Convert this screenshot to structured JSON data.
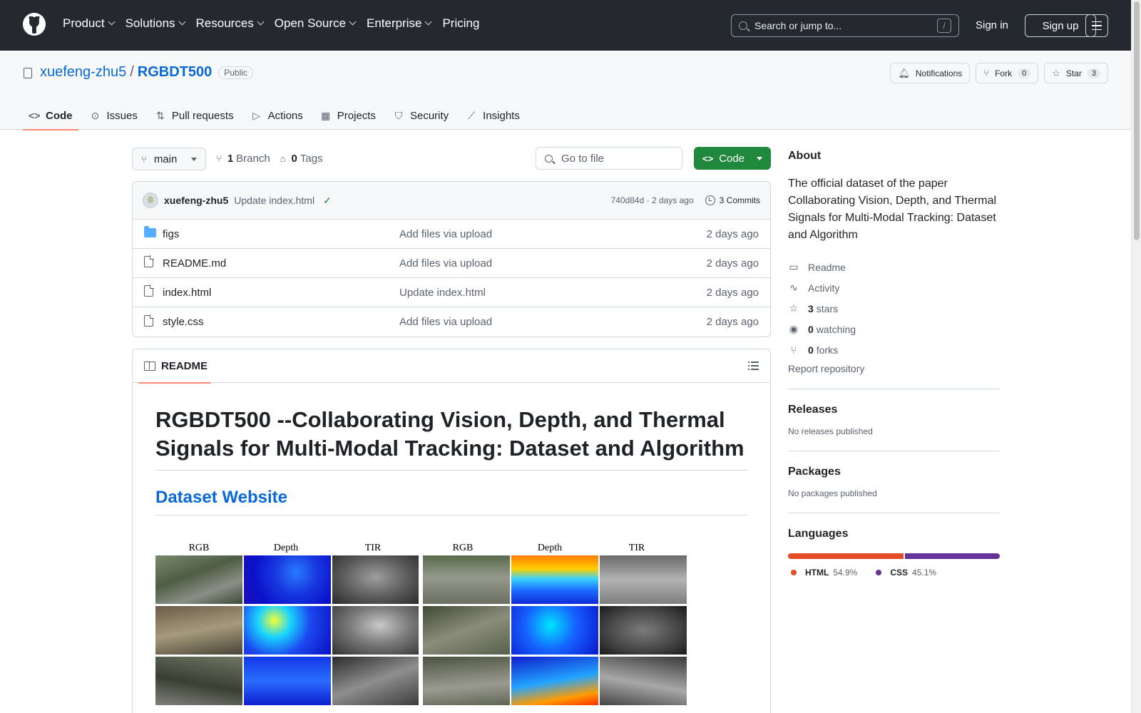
{
  "header": {
    "nav": [
      "Product",
      "Solutions",
      "Resources",
      "Open Source",
      "Enterprise",
      "Pricing"
    ],
    "search_placeholder": "Search or jump to...",
    "search_shortcut": "/",
    "signin": "Sign in",
    "signup": "Sign up"
  },
  "repo": {
    "owner": "xuefeng-zhu5",
    "separator": "/",
    "name": "RGBDT500",
    "visibility": "Public",
    "actions": {
      "notifications": "Notifications",
      "fork": "Fork",
      "fork_count": "0",
      "star": "Star",
      "star_count": "3"
    },
    "tabs": [
      "Code",
      "Issues",
      "Pull requests",
      "Actions",
      "Projects",
      "Security",
      "Insights"
    ]
  },
  "toolbar": {
    "branch": "main",
    "branch_count": "1",
    "branch_label": "Branch",
    "tag_count": "0",
    "tag_label": "Tags",
    "goto_placeholder": "Go to file",
    "code_button": "Code"
  },
  "latest_commit": {
    "author": "xuefeng-zhu5",
    "message": "Update index.html",
    "hash_time": "740d84d · 2 days ago",
    "commits": "3 Commits"
  },
  "files": [
    {
      "name": "figs",
      "type": "folder",
      "commit": "Add files via upload",
      "date": "2 days ago"
    },
    {
      "name": "README.md",
      "type": "file",
      "commit": "Add files via upload",
      "date": "2 days ago"
    },
    {
      "name": "index.html",
      "type": "file",
      "commit": "Update index.html",
      "date": "2 days ago"
    },
    {
      "name": "style.css",
      "type": "file",
      "commit": "Add files via upload",
      "date": "2 days ago"
    }
  ],
  "readme": {
    "tab": "README",
    "title": "RGBDT500 --Collaborating Vision, Depth, and Thermal Signals for Multi-Modal Tracking: Dataset and Algorithm",
    "link": "Dataset Website",
    "figure_labels": [
      "RGB",
      "Depth",
      "TIR",
      "RGB",
      "Depth",
      "TIR"
    ]
  },
  "about": {
    "heading": "About",
    "description": "The official dataset of the paper Collaborating Vision, Depth, and Thermal Signals for Multi-Modal Tracking: Dataset and Algorithm",
    "readme": "Readme",
    "activity": "Activity",
    "stars_count": "3",
    "stars_label": "stars",
    "watching_count": "0",
    "watching_label": "watching",
    "forks_count": "0",
    "forks_label": "forks",
    "report": "Report repository"
  },
  "releases": {
    "heading": "Releases",
    "text": "No releases published"
  },
  "packages": {
    "heading": "Packages",
    "text": "No packages published"
  },
  "languages": {
    "heading": "Languages",
    "items": [
      {
        "name": "HTML",
        "percent": "54.9%",
        "value": 54.9,
        "color": "#e34c26"
      },
      {
        "name": "CSS",
        "percent": "45.1%",
        "value": 45.1,
        "color": "#663399"
      }
    ]
  }
}
